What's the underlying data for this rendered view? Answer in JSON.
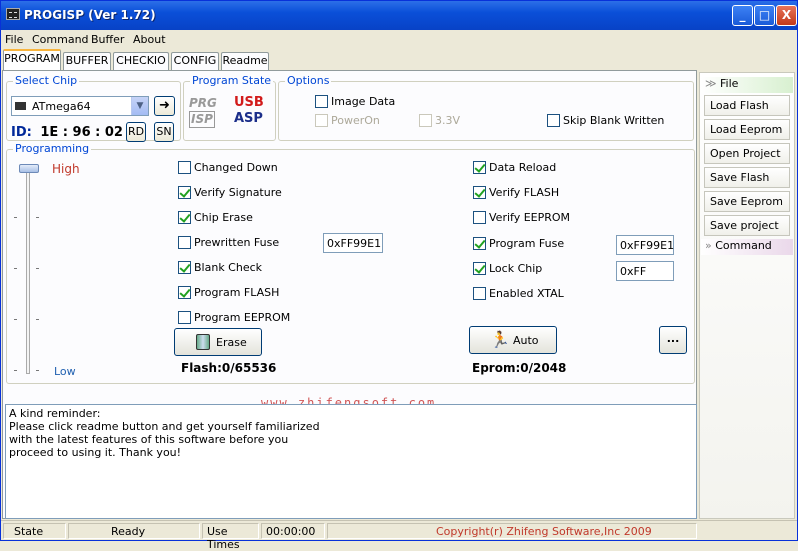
{
  "window": {
    "title": "PROGISP (Ver 1.72)",
    "minimize": "_",
    "maximize": "□",
    "close": "X"
  },
  "menu": [
    "File",
    "Command",
    "Buffer",
    "About"
  ],
  "tabs": [
    "PROGRAM",
    "BUFFER",
    "CHECKIO",
    "CONFIG",
    "Readme"
  ],
  "select_chip": {
    "label": "Select Chip",
    "chip": "ATmega64",
    "id_label": "ID:",
    "id_value": "1E : 96 : 02",
    "rd": "RD",
    "sn": "SN"
  },
  "program_state": {
    "label": "Program State",
    "logo_left_top": "PRG",
    "logo_left_bottom": "ISP",
    "logo_right_top": "USB",
    "logo_right_bottom": "ASP"
  },
  "options": {
    "label": "Options",
    "image_data": "Image Data",
    "power_on": "PowerOn",
    "v33": "3.3V",
    "skip_blank": "Skip Blank Written"
  },
  "programming": {
    "label": "Programming",
    "high": "High",
    "low": "Low",
    "left": [
      {
        "label": "Changed Down",
        "checked": false
      },
      {
        "label": "Verify Signature",
        "checked": true
      },
      {
        "label": "Chip Erase",
        "checked": true
      },
      {
        "label": "Prewritten Fuse",
        "checked": false
      },
      {
        "label": "Blank Check",
        "checked": true
      },
      {
        "label": "Program FLASH",
        "checked": true
      },
      {
        "label": "Program EEPROM",
        "checked": false
      }
    ],
    "right": [
      {
        "label": "Data Reload",
        "checked": true
      },
      {
        "label": "Verify FLASH",
        "checked": true
      },
      {
        "label": "Verify EEPROM",
        "checked": false
      },
      {
        "label": "Program Fuse",
        "checked": true
      },
      {
        "label": "Lock Chip",
        "checked": true
      },
      {
        "label": "Enabled XTAL",
        "checked": false
      }
    ],
    "prewritten_fuse_value": "0xFF99E1",
    "program_fuse_value": "0xFF99E1",
    "lock_chip_value": "0xFF",
    "erase": "Erase",
    "auto": "Auto",
    "more": "...",
    "flash": "Flash:0/65536",
    "eprom": "Eprom:0/2048"
  },
  "watermark": "www.zhifengsoft.com",
  "memo": [
    "A kind reminder:",
    "Please click readme button and get yourself familiarized",
    "with the latest features of this software before you",
    "proceed to using it. Thank you!"
  ],
  "status": {
    "state_label": "State",
    "state_value": "Ready",
    "use_times_label": "Use Times",
    "use_times_value": "00:00:00",
    "copyright": "Copyright(r) Zhifeng Software,Inc 2009"
  },
  "sidebar": {
    "file_header": "File",
    "buttons": [
      "Load Flash",
      "Load Eeprom",
      "Open Project",
      "Save Flash",
      "Save Eeprom",
      "Save project"
    ],
    "command_header": "Command"
  },
  "colors": {
    "accent": "#0046d5",
    "title_blue": "#0a4fd8",
    "copyright_red": "#c0392b",
    "high_low_red": "#c0392b"
  }
}
